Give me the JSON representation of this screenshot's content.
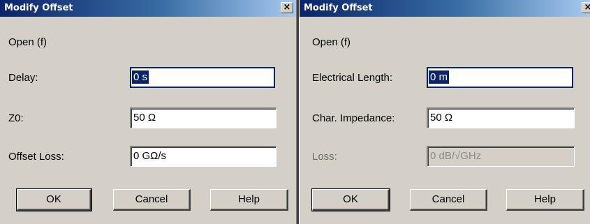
{
  "dialogs": [
    {
      "title": "Modify Offset",
      "close_glyph": "×",
      "standard": "Open (f)",
      "fields": [
        {
          "label": "Delay:",
          "value": "0 s",
          "state": "focused"
        },
        {
          "label": "Z0:",
          "value": "50 Ω",
          "state": "normal"
        },
        {
          "label": "Offset Loss:",
          "value": "0 GΩ/s",
          "state": "normal"
        }
      ],
      "buttons": {
        "ok": "OK",
        "cancel": "Cancel",
        "help": "Help"
      }
    },
    {
      "title": "Modify Offset",
      "close_glyph": "×",
      "standard": "Open (f)",
      "fields": [
        {
          "label": "Electrical Length:",
          "value": "0 m",
          "state": "focused"
        },
        {
          "label": "Char. Impedance:",
          "value": "50 Ω",
          "state": "normal"
        },
        {
          "label": "Loss:",
          "value": "0 dB/√GHz",
          "state": "disabled"
        }
      ],
      "buttons": {
        "ok": "OK",
        "cancel": "Cancel",
        "help": "Help"
      }
    }
  ],
  "colors": {
    "dialog_bg": "#d4d0c8",
    "titlebar_start": "#0a246a",
    "titlebar_end": "#a6caf0",
    "selection": "#0a246a"
  }
}
